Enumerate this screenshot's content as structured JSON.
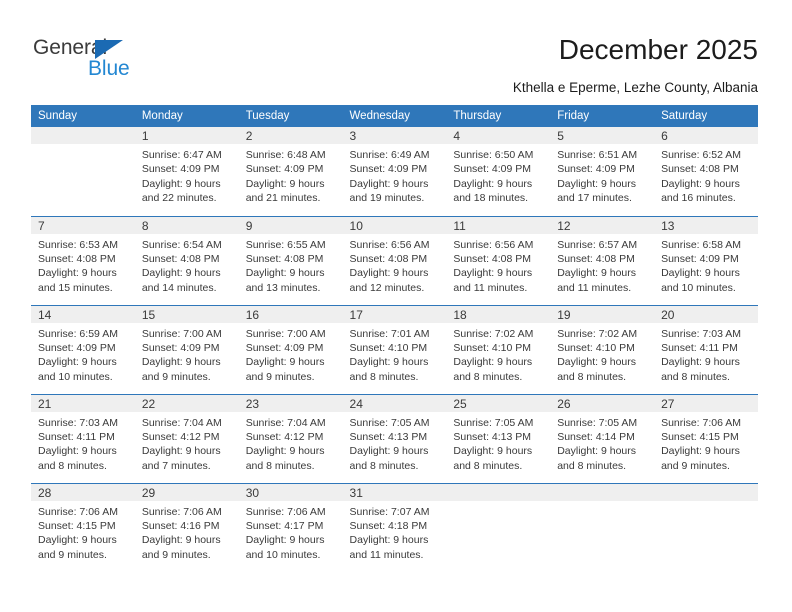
{
  "brand": {
    "name_part1": "General",
    "name_part2": "Blue",
    "triangle_color": "#1b6ab3",
    "blue_color": "#2387d2"
  },
  "header": {
    "title": "December 2025",
    "subtitle": "Kthella e Eperme, Lezhe County, Albania"
  },
  "theme": {
    "header_bg": "#2f77ba",
    "daynum_band_bg": "#efefef",
    "text_color": "#3a3a3a"
  },
  "calendar": {
    "weekday_headers": [
      "Sunday",
      "Monday",
      "Tuesday",
      "Wednesday",
      "Thursday",
      "Friday",
      "Saturday"
    ],
    "weeks": [
      [
        {
          "day": "",
          "lines": []
        },
        {
          "day": "1",
          "lines": [
            "Sunrise: 6:47 AM",
            "Sunset: 4:09 PM",
            "Daylight: 9 hours",
            "and 22 minutes."
          ]
        },
        {
          "day": "2",
          "lines": [
            "Sunrise: 6:48 AM",
            "Sunset: 4:09 PM",
            "Daylight: 9 hours",
            "and 21 minutes."
          ]
        },
        {
          "day": "3",
          "lines": [
            "Sunrise: 6:49 AM",
            "Sunset: 4:09 PM",
            "Daylight: 9 hours",
            "and 19 minutes."
          ]
        },
        {
          "day": "4",
          "lines": [
            "Sunrise: 6:50 AM",
            "Sunset: 4:09 PM",
            "Daylight: 9 hours",
            "and 18 minutes."
          ]
        },
        {
          "day": "5",
          "lines": [
            "Sunrise: 6:51 AM",
            "Sunset: 4:09 PM",
            "Daylight: 9 hours",
            "and 17 minutes."
          ]
        },
        {
          "day": "6",
          "lines": [
            "Sunrise: 6:52 AM",
            "Sunset: 4:08 PM",
            "Daylight: 9 hours",
            "and 16 minutes."
          ]
        }
      ],
      [
        {
          "day": "7",
          "lines": [
            "Sunrise: 6:53 AM",
            "Sunset: 4:08 PM",
            "Daylight: 9 hours",
            "and 15 minutes."
          ]
        },
        {
          "day": "8",
          "lines": [
            "Sunrise: 6:54 AM",
            "Sunset: 4:08 PM",
            "Daylight: 9 hours",
            "and 14 minutes."
          ]
        },
        {
          "day": "9",
          "lines": [
            "Sunrise: 6:55 AM",
            "Sunset: 4:08 PM",
            "Daylight: 9 hours",
            "and 13 minutes."
          ]
        },
        {
          "day": "10",
          "lines": [
            "Sunrise: 6:56 AM",
            "Sunset: 4:08 PM",
            "Daylight: 9 hours",
            "and 12 minutes."
          ]
        },
        {
          "day": "11",
          "lines": [
            "Sunrise: 6:56 AM",
            "Sunset: 4:08 PM",
            "Daylight: 9 hours",
            "and 11 minutes."
          ]
        },
        {
          "day": "12",
          "lines": [
            "Sunrise: 6:57 AM",
            "Sunset: 4:08 PM",
            "Daylight: 9 hours",
            "and 11 minutes."
          ]
        },
        {
          "day": "13",
          "lines": [
            "Sunrise: 6:58 AM",
            "Sunset: 4:09 PM",
            "Daylight: 9 hours",
            "and 10 minutes."
          ]
        }
      ],
      [
        {
          "day": "14",
          "lines": [
            "Sunrise: 6:59 AM",
            "Sunset: 4:09 PM",
            "Daylight: 9 hours",
            "and 10 minutes."
          ]
        },
        {
          "day": "15",
          "lines": [
            "Sunrise: 7:00 AM",
            "Sunset: 4:09 PM",
            "Daylight: 9 hours",
            "and 9 minutes."
          ]
        },
        {
          "day": "16",
          "lines": [
            "Sunrise: 7:00 AM",
            "Sunset: 4:09 PM",
            "Daylight: 9 hours",
            "and 9 minutes."
          ]
        },
        {
          "day": "17",
          "lines": [
            "Sunrise: 7:01 AM",
            "Sunset: 4:10 PM",
            "Daylight: 9 hours",
            "and 8 minutes."
          ]
        },
        {
          "day": "18",
          "lines": [
            "Sunrise: 7:02 AM",
            "Sunset: 4:10 PM",
            "Daylight: 9 hours",
            "and 8 minutes."
          ]
        },
        {
          "day": "19",
          "lines": [
            "Sunrise: 7:02 AM",
            "Sunset: 4:10 PM",
            "Daylight: 9 hours",
            "and 8 minutes."
          ]
        },
        {
          "day": "20",
          "lines": [
            "Sunrise: 7:03 AM",
            "Sunset: 4:11 PM",
            "Daylight: 9 hours",
            "and 8 minutes."
          ]
        }
      ],
      [
        {
          "day": "21",
          "lines": [
            "Sunrise: 7:03 AM",
            "Sunset: 4:11 PM",
            "Daylight: 9 hours",
            "and 8 minutes."
          ]
        },
        {
          "day": "22",
          "lines": [
            "Sunrise: 7:04 AM",
            "Sunset: 4:12 PM",
            "Daylight: 9 hours",
            "and 7 minutes."
          ]
        },
        {
          "day": "23",
          "lines": [
            "Sunrise: 7:04 AM",
            "Sunset: 4:12 PM",
            "Daylight: 9 hours",
            "and 8 minutes."
          ]
        },
        {
          "day": "24",
          "lines": [
            "Sunrise: 7:05 AM",
            "Sunset: 4:13 PM",
            "Daylight: 9 hours",
            "and 8 minutes."
          ]
        },
        {
          "day": "25",
          "lines": [
            "Sunrise: 7:05 AM",
            "Sunset: 4:13 PM",
            "Daylight: 9 hours",
            "and 8 minutes."
          ]
        },
        {
          "day": "26",
          "lines": [
            "Sunrise: 7:05 AM",
            "Sunset: 4:14 PM",
            "Daylight: 9 hours",
            "and 8 minutes."
          ]
        },
        {
          "day": "27",
          "lines": [
            "Sunrise: 7:06 AM",
            "Sunset: 4:15 PM",
            "Daylight: 9 hours",
            "and 9 minutes."
          ]
        }
      ],
      [
        {
          "day": "28",
          "lines": [
            "Sunrise: 7:06 AM",
            "Sunset: 4:15 PM",
            "Daylight: 9 hours",
            "and 9 minutes."
          ]
        },
        {
          "day": "29",
          "lines": [
            "Sunrise: 7:06 AM",
            "Sunset: 4:16 PM",
            "Daylight: 9 hours",
            "and 9 minutes."
          ]
        },
        {
          "day": "30",
          "lines": [
            "Sunrise: 7:06 AM",
            "Sunset: 4:17 PM",
            "Daylight: 9 hours",
            "and 10 minutes."
          ]
        },
        {
          "day": "31",
          "lines": [
            "Sunrise: 7:07 AM",
            "Sunset: 4:18 PM",
            "Daylight: 9 hours",
            "and 11 minutes."
          ]
        },
        {
          "day": "",
          "lines": []
        },
        {
          "day": "",
          "lines": []
        },
        {
          "day": "",
          "lines": []
        }
      ]
    ]
  }
}
